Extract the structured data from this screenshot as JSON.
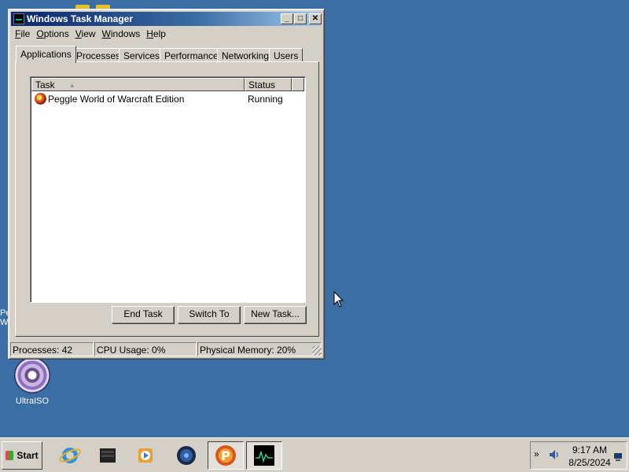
{
  "window": {
    "title": "Windows Task Manager",
    "caption_buttons": {
      "minimize": "_",
      "maximize": "□",
      "close": "✕"
    }
  },
  "menu": [
    {
      "label": "File",
      "accel": "F",
      "rest": "ile"
    },
    {
      "label": "Options",
      "accel": "O",
      "rest": "ptions"
    },
    {
      "label": "View",
      "accel": "V",
      "rest": "iew"
    },
    {
      "label": "Windows",
      "accel": "W",
      "rest": "indows"
    },
    {
      "label": "Help",
      "accel": "H",
      "rest": "elp"
    }
  ],
  "tabs": [
    {
      "label": "Applications",
      "active": true
    },
    {
      "label": "Processes",
      "active": false
    },
    {
      "label": "Services",
      "active": false
    },
    {
      "label": "Performance",
      "active": false
    },
    {
      "label": "Networking",
      "active": false
    },
    {
      "label": "Users",
      "active": false
    }
  ],
  "task_list": {
    "columns": {
      "task": "Task",
      "status": "Status"
    },
    "rows": [
      {
        "name": "Peggle World of Warcraft Edition",
        "status": "Running",
        "icon": "peggle-icon"
      }
    ]
  },
  "buttons": {
    "end_task": "End Task",
    "switch_to": "Switch To",
    "new_task": "New Task..."
  },
  "statusbar": {
    "processes": "Processes: 42",
    "cpu": "CPU Usage: 0%",
    "memory": "Physical Memory: 20%"
  },
  "desktop": {
    "ultraiso_label": "UltraISO",
    "peek_text_1": "Pe",
    "peek_text_2": "W",
    "background": "#3a6ea5"
  },
  "taskbar": {
    "start_label": "Start",
    "apps": [
      "internet-explorer-icon",
      "server-manager-icon",
      "windows-media-player-icon",
      "network-globe-icon",
      "peggle-icon",
      "task-manager-icon"
    ],
    "clock_time": "9:17 AM",
    "clock_date": "8/25/2024",
    "tray_chevron": "»"
  }
}
